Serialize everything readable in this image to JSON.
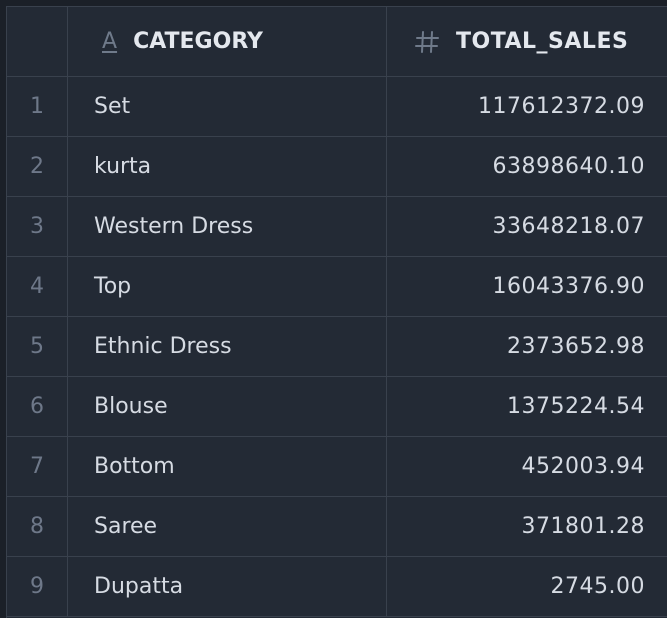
{
  "columns": {
    "category_icon": "text-type-icon",
    "category": "CATEGORY",
    "sales_icon": "number-type-icon",
    "sales": "TOTAL_SALES"
  },
  "rows": [
    {
      "index": "1",
      "category": "Set",
      "total_sales": "117612372.09"
    },
    {
      "index": "2",
      "category": "kurta",
      "total_sales": "63898640.10"
    },
    {
      "index": "3",
      "category": "Western Dress",
      "total_sales": "33648218.07"
    },
    {
      "index": "4",
      "category": "Top",
      "total_sales": "16043376.90"
    },
    {
      "index": "5",
      "category": "Ethnic Dress",
      "total_sales": "2373652.98"
    },
    {
      "index": "6",
      "category": "Blouse",
      "total_sales": "1375224.54"
    },
    {
      "index": "7",
      "category": "Bottom",
      "total_sales": "452003.94"
    },
    {
      "index": "8",
      "category": "Saree",
      "total_sales": "371801.28"
    },
    {
      "index": "9",
      "category": "Dupatta",
      "total_sales": "2745.00"
    }
  ],
  "colors": {
    "background": "#232a35",
    "grid": "#39414d",
    "text": "#d6dbe3",
    "index_text": "#6e7889"
  }
}
